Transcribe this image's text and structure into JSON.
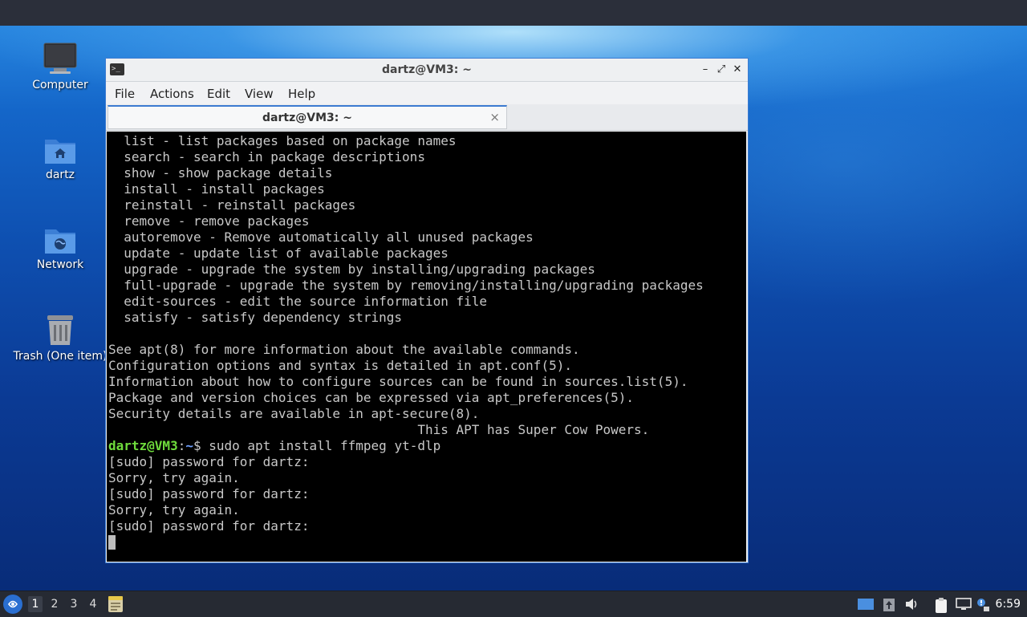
{
  "desktop": {
    "icons": [
      {
        "label": "Computer"
      },
      {
        "label": "dartz"
      },
      {
        "label": "Network"
      },
      {
        "label": "Trash (One item)"
      }
    ]
  },
  "window": {
    "title": "dartz@VM3: ~",
    "menu": [
      "File",
      "Actions",
      "Edit",
      "View",
      "Help"
    ],
    "tab_label": "dartz@VM3: ~",
    "tab_close": "×",
    "buttons": {
      "minimize": "–",
      "maximize": "⤢",
      "close": "✕"
    }
  },
  "terminal": {
    "lines": [
      "  list - list packages based on package names",
      "  search - search in package descriptions",
      "  show - show package details",
      "  install - install packages",
      "  reinstall - reinstall packages",
      "  remove - remove packages",
      "  autoremove - Remove automatically all unused packages",
      "  update - update list of available packages",
      "  upgrade - upgrade the system by installing/upgrading packages",
      "  full-upgrade - upgrade the system by removing/installing/upgrading packages",
      "  edit-sources - edit the source information file",
      "  satisfy - satisfy dependency strings",
      "",
      "See apt(8) for more information about the available commands.",
      "Configuration options and syntax is detailed in apt.conf(5).",
      "Information about how to configure sources can be found in sources.list(5).",
      "Package and version choices can be expressed via apt_preferences(5).",
      "Security details are available in apt-secure(8).",
      "                                        This APT has Super Cow Powers."
    ],
    "prompt_user": "dartz@VM3",
    "prompt_sep": ":",
    "prompt_path": "~",
    "prompt_symbol": "$ ",
    "command": "sudo apt install ffmpeg yt-dlp",
    "after_lines": [
      "[sudo] password for dartz:",
      "Sorry, try again.",
      "[sudo] password for dartz:",
      "Sorry, try again.",
      "[sudo] password for dartz:"
    ]
  },
  "taskbar": {
    "workspaces": [
      "1",
      "2",
      "3",
      "4"
    ],
    "active_workspace": "1",
    "clock": "6:59"
  }
}
